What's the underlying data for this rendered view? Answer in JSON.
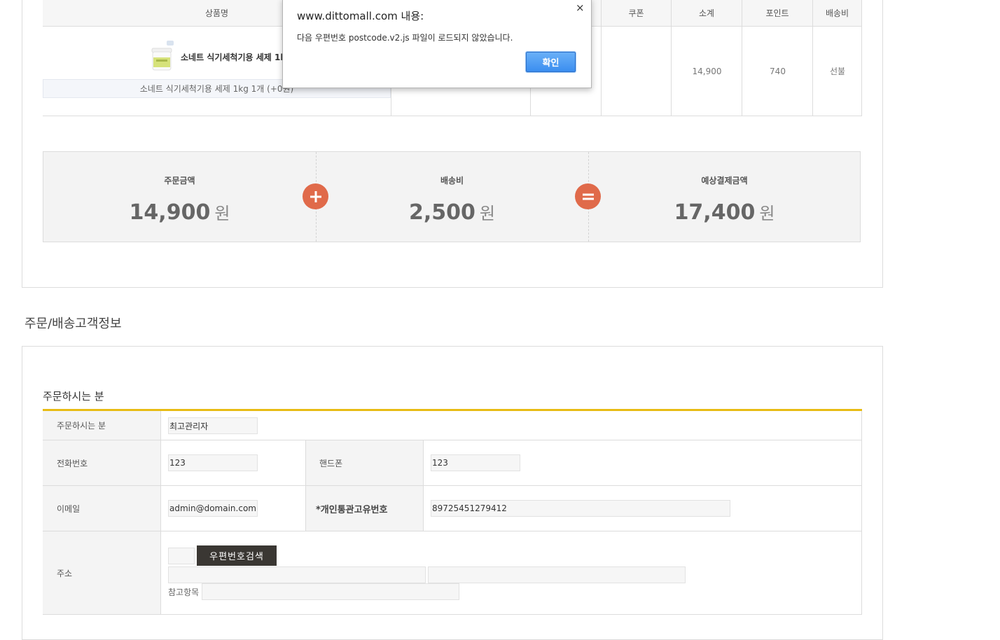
{
  "cart": {
    "headers": {
      "product_name": "상품명",
      "coupon": "쿠폰",
      "subtotal": "소계",
      "point": "포인트",
      "shipping": "배송비"
    },
    "item": {
      "name": "소네트 식기세척기용 세제 1kg",
      "option": "소네트 식기세척기용 세제 1kg 1개 (+0원)",
      "subtotal": "14,900",
      "point": "740",
      "shipping": "선불"
    }
  },
  "summary": {
    "order_amount_label": "주문금액",
    "order_amount": "14,900",
    "shipping_label": "배송비",
    "shipping_amount": "2,500",
    "total_label": "예상결제금액",
    "total_amount": "17,400",
    "unit": "원",
    "plus": "+",
    "equals": "="
  },
  "section_title": "주문/배송고객정보",
  "orderer": {
    "title": "주문하시는 분",
    "name_label": "주문하시는 분",
    "name_value": "최고관리자",
    "phone_label": "전화번호",
    "phone_value": "123",
    "mobile_label": "핸드폰",
    "mobile_value": "123",
    "email_label": "이메일",
    "email_value": "admin@domain.com",
    "customs_label": "*개인통관고유번호",
    "customs_value": "89725451279412",
    "address_label": "주소",
    "postcode_search_label": "우편번호검색",
    "ref_label": "참고항목"
  },
  "dialog": {
    "title": "www.dittomall.com 내용:",
    "message": "다음 우편번호 postcode.v2.js 파일이 로드되지 않았습니다.",
    "ok_label": "확인",
    "close_symbol": "×"
  },
  "colors": {
    "accent_yellow": "#e8bc14",
    "operator_orange": "#e06a4a",
    "dialog_button_blue": "#3b8ef0"
  }
}
